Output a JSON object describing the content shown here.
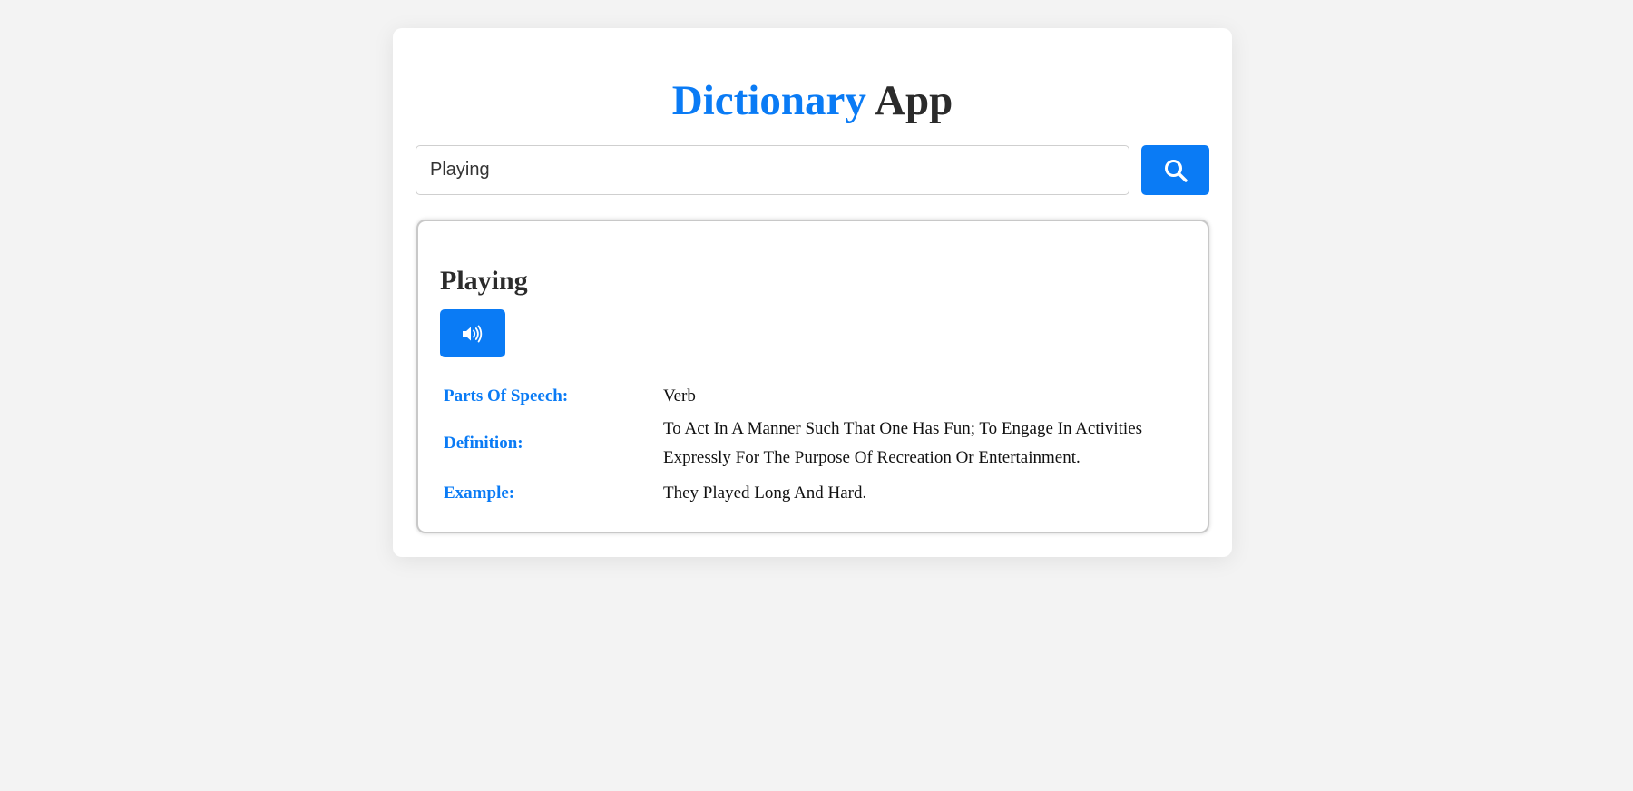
{
  "header": {
    "title_accent": "Dictionary",
    "title_rest": "App"
  },
  "search": {
    "value": "Playing",
    "placeholder": "",
    "button_icon": "search-icon"
  },
  "result": {
    "word": "Playing",
    "audio_icon": "speaker-icon",
    "rows": [
      {
        "label": "Parts Of Speech:",
        "value": "Verb"
      },
      {
        "label": "Definition:",
        "value": "To Act In A Manner Such That One Has Fun; To Engage In Activities Expressly For The Purpose Of Recreation Or Entertainment."
      },
      {
        "label": "Example:",
        "value": "They Played Long And Hard."
      }
    ]
  },
  "colors": {
    "accent": "#0a7bf5",
    "background": "#f3f3f3",
    "card": "#ffffff",
    "heading": "#2b2b2b"
  }
}
